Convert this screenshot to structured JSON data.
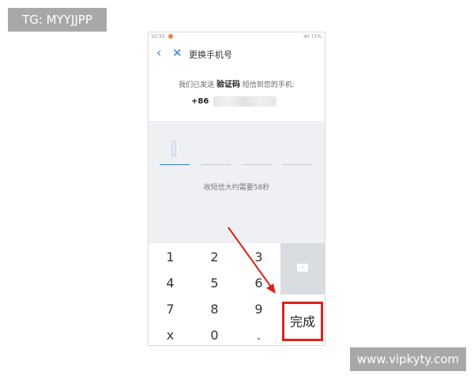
{
  "watermarks": {
    "top_left": "TG: MYYJJPP",
    "bottom_right": "www.vipkyty.com"
  },
  "status_bar": {
    "time": "10:33",
    "right": "40 71%"
  },
  "app_bar": {
    "back_icon": "chevron-left",
    "close_icon": "x",
    "title": "更换手机号"
  },
  "message": {
    "prefix": "我们已发送",
    "keyword": "验证码",
    "suffix": "短信到您的手机:",
    "country_code": "+86",
    "phone_redacted": true
  },
  "code_input": {
    "slots": 4,
    "active_slot": 1,
    "hint": "收短信大约需要58秒"
  },
  "keypad": {
    "keys": [
      "1",
      "2",
      "3",
      "4",
      "5",
      "6",
      "7",
      "8",
      "9",
      "x",
      "0",
      "."
    ],
    "delete_icon": "backspace",
    "done_label": "完成"
  },
  "annotation": {
    "highlight_color": "#d9241c",
    "arrow_color": "#d9241c"
  }
}
